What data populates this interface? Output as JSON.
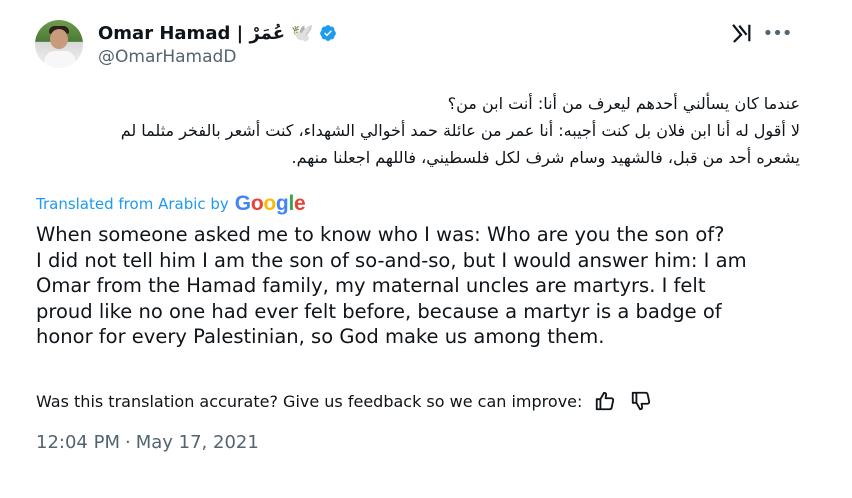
{
  "author": {
    "display_name": "Omar Hamad | عُمَرْ 🕊️",
    "handle": "@OmarHamadD",
    "verified": true,
    "verified_color": "#1d9bf0"
  },
  "tweet": {
    "original_lines": [
      "عندما كان يسألني أحدهم ليعرف من أنا: أنت ابن من؟",
      "لا أقول له أنا ابن فلان بل كنت أجيبه: أنا عمر من عائلة حمد أخوالي الشهداء، كنت أشعر بالفخر مثلما لم",
      "يشعره أحد من قبل، فالشهيد وسام شرف لكل فلسطيني، فاللهم اجعلنا منهم."
    ],
    "translated_label": "Translated from Arabic by",
    "translation_provider": "Google",
    "translation_lines": [
      "When someone asked me to know who I was: Who are you the son of?",
      "I did not tell him I am the son of so-and-so, but I would answer him: I am",
      "Omar from the Hamad family, my maternal uncles are martyrs. I felt",
      "proud like no one had ever felt before, because a martyr is a badge of",
      "honor for every Palestinian, so God make us among them."
    ],
    "feedback_prompt": "Was this translation accurate? Give us feedback so we can improve:",
    "time": "12:04 PM",
    "date": "May 17, 2021",
    "separator": "·"
  },
  "icons": {
    "xai": "grok-xai-icon",
    "more": "more-options-icon",
    "thumbs_up": "thumbs-up-icon",
    "thumbs_down": "thumbs-down-icon"
  },
  "colors": {
    "link": "#1d9bf0",
    "secondary_text": "#536471",
    "primary_text": "#0f1419"
  }
}
